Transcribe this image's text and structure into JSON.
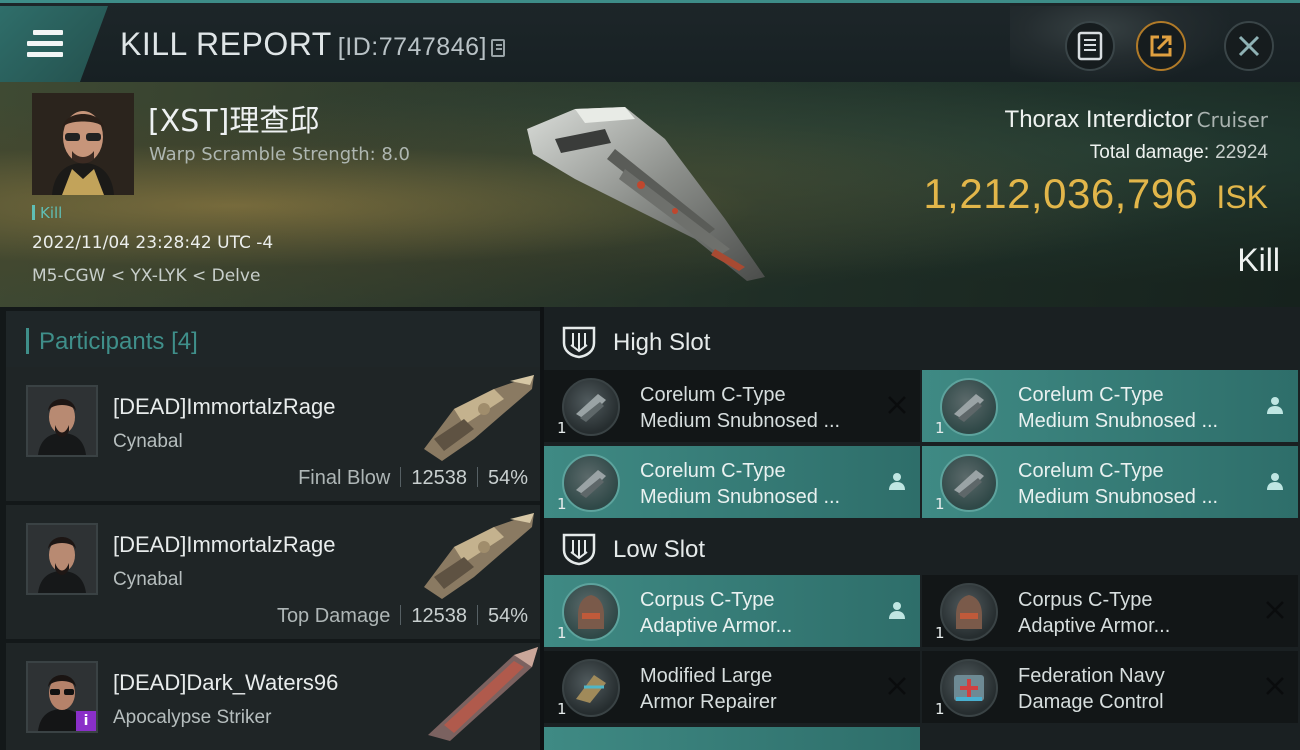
{
  "header": {
    "title": "KILL REPORT",
    "report_id": "[ID:7747846]",
    "buttons": [
      "clipboard-icon",
      "share-icon",
      "close-icon"
    ]
  },
  "victim": {
    "pilot": "[XST]理查邱",
    "attribute": "Warp Scramble Strength: 8.0",
    "tag": "Kill",
    "datetime": "2022/11/04 23:28:42 UTC -4",
    "location": "M5-CGW < YX-LYK < Delve",
    "ship_name": "Thorax Interdictor",
    "ship_class": "Cruiser",
    "total_damage_label": "Total damage:",
    "total_damage": "22924",
    "isk_value": "1,212,036,796",
    "isk_unit": "ISK",
    "result": "Kill"
  },
  "participants": {
    "title": "Participants",
    "count": "[4]",
    "items": [
      {
        "name": "[DEAD]ImmortalzRage",
        "ship": "Cynabal",
        "label": "Final Blow",
        "damage": "12538",
        "percent": "54%"
      },
      {
        "name": "[DEAD]ImmortalzRage",
        "ship": "Cynabal",
        "label": "Top Damage",
        "damage": "12538",
        "percent": "54%"
      },
      {
        "name": "[DEAD]Dark_Waters96",
        "ship": "Apocalypse Striker",
        "label": "",
        "damage": "",
        "percent": ""
      }
    ]
  },
  "slots": {
    "high": {
      "title": "High Slot",
      "modules": [
        {
          "line1": "Corelum C-Type",
          "line2": "Medium Snubnosed ...",
          "qty": "1",
          "status": "destroyed"
        },
        {
          "line1": "Corelum C-Type",
          "line2": "Medium Snubnosed ...",
          "qty": "1",
          "status": "dropped"
        },
        {
          "line1": "Corelum C-Type",
          "line2": "Medium Snubnosed ...",
          "qty": "1",
          "status": "dropped"
        },
        {
          "line1": "Corelum C-Type",
          "line2": "Medium Snubnosed ...",
          "qty": "1",
          "status": "dropped"
        }
      ]
    },
    "low": {
      "title": "Low Slot",
      "modules": [
        {
          "line1": "Corpus C-Type",
          "line2": "Adaptive Armor...",
          "qty": "1",
          "status": "dropped"
        },
        {
          "line1": "Corpus C-Type",
          "line2": "Adaptive Armor...",
          "qty": "1",
          "status": "destroyed"
        },
        {
          "line1": "Modified Large",
          "line2": "Armor Repairer",
          "qty": "1",
          "status": "destroyed"
        },
        {
          "line1": "Federation Navy",
          "line2": "Damage Control",
          "qty": "1",
          "status": "destroyed"
        }
      ]
    }
  },
  "colors": {
    "accent": "#3f8a84",
    "isk": "#e2b64a",
    "faction_badge": "#8a2fc8"
  }
}
